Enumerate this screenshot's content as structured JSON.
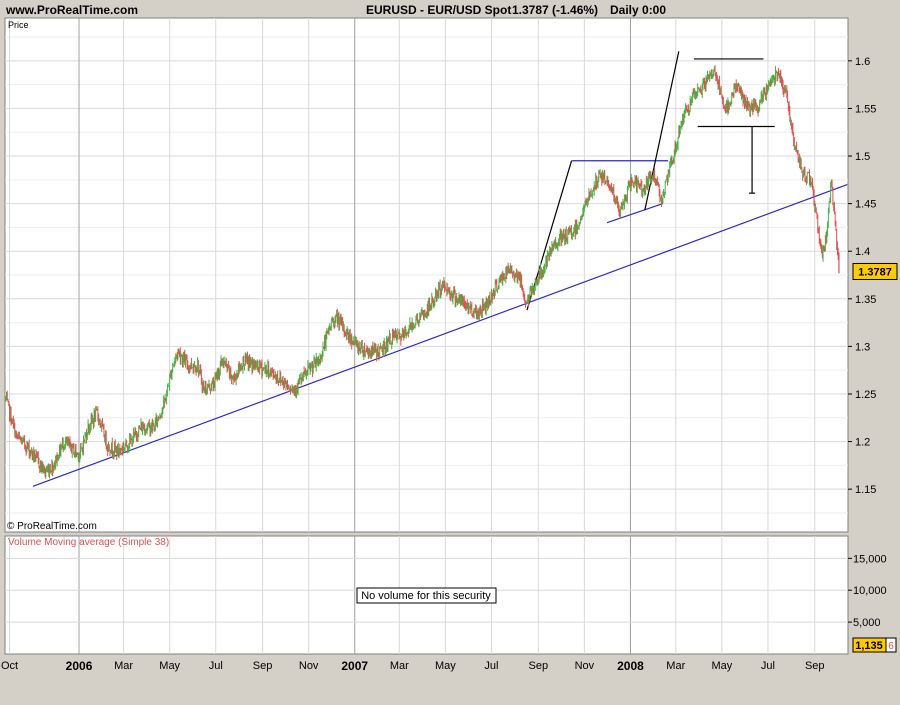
{
  "header": {
    "site": "www.ProRealTime.com",
    "instrument": "EURUSD - EUR/USD Spot",
    "quote": "1.3787 (-1.46%)",
    "timeframe": "Daily  0:00"
  },
  "price_panel": {
    "label": "Price",
    "watermark": "© ProRealTime.com",
    "last_price": "1.3787"
  },
  "volume_panel": {
    "title": "Volume Moving average (Simple 38)",
    "message": "No volume for this security",
    "last_value": "1,135",
    "last_value_suffix": "6"
  },
  "colors": {
    "up": "#3fb53f",
    "down": "#e05050",
    "trendline": "#2a2ac8",
    "drawing": "#000000",
    "grid": "#d9d9d9",
    "price_badge": "#ffcc00"
  },
  "chart_data": [
    {
      "type": "line",
      "title": "EURUSD - EUR/USD Spot",
      "y_scale": "linear",
      "ylim": [
        1.105,
        1.645
      ],
      "y_ticks": [
        1.15,
        1.2,
        1.25,
        1.3,
        1.35,
        1.4,
        1.45,
        1.5,
        1.55,
        1.6
      ],
      "y_tick_labels": [
        "1.15",
        "1.2",
        "1.25",
        "1.3",
        "1.35",
        "1.4",
        "1.45",
        "1.5",
        "1.55",
        "1.6"
      ],
      "xlim": [
        "2005-09-25",
        "2008-10-15"
      ],
      "x_ticks": [
        {
          "date": "2005-10-01",
          "label": "Oct",
          "bold": false,
          "vline": false
        },
        {
          "date": "2006-01-01",
          "label": "2006",
          "bold": true,
          "vline": true
        },
        {
          "date": "2006-03-01",
          "label": "Mar",
          "bold": false,
          "vline": false
        },
        {
          "date": "2006-05-01",
          "label": "May",
          "bold": false,
          "vline": false
        },
        {
          "date": "2006-07-01",
          "label": "Jul",
          "bold": false,
          "vline": false
        },
        {
          "date": "2006-09-01",
          "label": "Sep",
          "bold": false,
          "vline": false
        },
        {
          "date": "2006-11-01",
          "label": "Nov",
          "bold": false,
          "vline": false
        },
        {
          "date": "2007-01-01",
          "label": "2007",
          "bold": true,
          "vline": true
        },
        {
          "date": "2007-03-01",
          "label": "Mar",
          "bold": false,
          "vline": false
        },
        {
          "date": "2007-05-01",
          "label": "May",
          "bold": false,
          "vline": false
        },
        {
          "date": "2007-07-01",
          "label": "Jul",
          "bold": false,
          "vline": false
        },
        {
          "date": "2007-09-01",
          "label": "Sep",
          "bold": false,
          "vline": false
        },
        {
          "date": "2007-11-01",
          "label": "Nov",
          "bold": false,
          "vline": false
        },
        {
          "date": "2008-01-01",
          "label": "2008",
          "bold": true,
          "vline": true
        },
        {
          "date": "2008-03-01",
          "label": "Mar",
          "bold": false,
          "vline": false
        },
        {
          "date": "2008-05-01",
          "label": "May",
          "bold": false,
          "vline": false
        },
        {
          "date": "2008-07-01",
          "label": "Jul",
          "bold": false,
          "vline": false
        },
        {
          "date": "2008-09-01",
          "label": "Sep",
          "bold": false,
          "vline": false
        }
      ],
      "grid": true,
      "series": [
        {
          "style": "daily-bars",
          "points": [
            [
              "2005-09-26",
              1.245
            ],
            [
              "2005-10-10",
              1.205
            ],
            [
              "2005-10-24",
              1.195
            ],
            [
              "2005-11-07",
              1.18
            ],
            [
              "2005-11-17",
              1.168
            ],
            [
              "2005-11-28",
              1.175
            ],
            [
              "2005-12-12",
              1.2
            ],
            [
              "2006-01-02",
              1.185
            ],
            [
              "2006-01-13",
              1.215
            ],
            [
              "2006-01-25",
              1.23
            ],
            [
              "2006-02-08",
              1.195
            ],
            [
              "2006-02-22",
              1.19
            ],
            [
              "2006-03-10",
              1.2
            ],
            [
              "2006-03-24",
              1.215
            ],
            [
              "2006-04-10",
              1.215
            ],
            [
              "2006-04-24",
              1.24
            ],
            [
              "2006-05-05",
              1.28
            ],
            [
              "2006-05-12",
              1.295
            ],
            [
              "2006-05-25",
              1.28
            ],
            [
              "2006-06-07",
              1.28
            ],
            [
              "2006-06-15",
              1.255
            ],
            [
              "2006-06-28",
              1.26
            ],
            [
              "2006-07-10",
              1.285
            ],
            [
              "2006-07-24",
              1.265
            ],
            [
              "2006-08-07",
              1.285
            ],
            [
              "2006-08-21",
              1.28
            ],
            [
              "2006-09-08",
              1.275
            ],
            [
              "2006-09-25",
              1.265
            ],
            [
              "2006-10-13",
              1.255
            ],
            [
              "2006-11-01",
              1.275
            ],
            [
              "2006-11-15",
              1.285
            ],
            [
              "2006-12-01",
              1.325
            ],
            [
              "2006-12-08",
              1.33
            ],
            [
              "2006-12-20",
              1.315
            ],
            [
              "2007-01-05",
              1.3
            ],
            [
              "2007-01-19",
              1.295
            ],
            [
              "2007-02-05",
              1.295
            ],
            [
              "2007-02-20",
              1.31
            ],
            [
              "2007-03-05",
              1.31
            ],
            [
              "2007-03-20",
              1.325
            ],
            [
              "2007-04-05",
              1.335
            ],
            [
              "2007-04-20",
              1.355
            ],
            [
              "2007-04-27",
              1.365
            ],
            [
              "2007-05-10",
              1.355
            ],
            [
              "2007-05-25",
              1.345
            ],
            [
              "2007-06-12",
              1.335
            ],
            [
              "2007-06-25",
              1.345
            ],
            [
              "2007-07-09",
              1.365
            ],
            [
              "2007-07-24",
              1.38
            ],
            [
              "2007-08-06",
              1.375
            ],
            [
              "2007-08-16",
              1.345
            ],
            [
              "2007-08-27",
              1.365
            ],
            [
              "2007-09-10",
              1.385
            ],
            [
              "2007-09-24",
              1.41
            ],
            [
              "2007-10-08",
              1.415
            ],
            [
              "2007-10-22",
              1.425
            ],
            [
              "2007-11-06",
              1.455
            ],
            [
              "2007-11-22",
              1.48
            ],
            [
              "2007-12-05",
              1.47
            ],
            [
              "2007-12-18",
              1.44
            ],
            [
              "2008-01-03",
              1.475
            ],
            [
              "2008-01-17",
              1.465
            ],
            [
              "2008-02-01",
              1.48
            ],
            [
              "2008-02-12",
              1.455
            ],
            [
              "2008-02-27",
              1.5
            ],
            [
              "2008-03-10",
              1.54
            ],
            [
              "2008-03-24",
              1.56
            ],
            [
              "2008-04-07",
              1.575
            ],
            [
              "2008-04-22",
              1.59
            ],
            [
              "2008-05-05",
              1.545
            ],
            [
              "2008-05-20",
              1.575
            ],
            [
              "2008-06-05",
              1.55
            ],
            [
              "2008-06-18",
              1.55
            ],
            [
              "2008-07-02",
              1.575
            ],
            [
              "2008-07-15",
              1.59
            ],
            [
              "2008-07-25",
              1.565
            ],
            [
              "2008-08-08",
              1.5
            ],
            [
              "2008-08-18",
              1.48
            ],
            [
              "2008-08-28",
              1.475
            ],
            [
              "2008-09-05",
              1.425
            ],
            [
              "2008-09-11",
              1.395
            ],
            [
              "2008-09-16",
              1.415
            ],
            [
              "2008-09-23",
              1.475
            ],
            [
              "2008-09-30",
              1.41
            ],
            [
              "2008-10-03",
              1.3787
            ]
          ]
        }
      ],
      "drawings": [
        {
          "kind": "trendline",
          "color": "trendline",
          "from": [
            "2005-11-01",
            1.153
          ],
          "to": [
            "2008-10-14",
            1.47
          ]
        },
        {
          "kind": "segment",
          "color": "drawing",
          "from": [
            "2007-08-17",
            1.338
          ],
          "to": [
            "2007-10-15",
            1.495
          ]
        },
        {
          "kind": "segment",
          "color": "trendline",
          "from": [
            "2007-10-15",
            1.495
          ],
          "to": [
            "2008-02-20",
            1.495
          ]
        },
        {
          "kind": "segment",
          "color": "trendline",
          "from": [
            "2007-12-01",
            1.43
          ],
          "to": [
            "2008-02-13",
            1.45
          ]
        },
        {
          "kind": "segment",
          "color": "drawing",
          "from": [
            "2008-01-20",
            1.443
          ],
          "to": [
            "2008-03-05",
            1.61
          ]
        },
        {
          "kind": "segment",
          "color": "drawing",
          "from": [
            "2008-03-25",
            1.602
          ],
          "to": [
            "2008-06-25",
            1.602
          ]
        },
        {
          "kind": "segment",
          "color": "drawing",
          "from": [
            "2008-03-30",
            1.531
          ],
          "to": [
            "2008-07-10",
            1.531
          ]
        },
        {
          "kind": "segment",
          "color": "drawing",
          "from": [
            "2008-06-10",
            1.531
          ],
          "to": [
            "2008-06-10",
            1.461
          ]
        },
        {
          "kind": "segment",
          "color": "drawing",
          "from": [
            "2008-06-06",
            1.461
          ],
          "to": [
            "2008-06-14",
            1.461
          ]
        }
      ]
    },
    {
      "type": "line",
      "title": "Volume Moving average (Simple 38)",
      "ylim": [
        0,
        18500
      ],
      "y_ticks": [
        5000,
        10000,
        15000
      ],
      "y_tick_labels": [
        "5,000",
        "10,000",
        "15,000"
      ],
      "series": []
    }
  ]
}
